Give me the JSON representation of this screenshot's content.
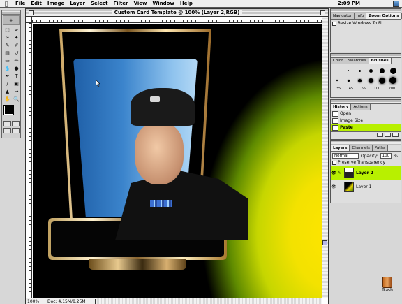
{
  "menubar": {
    "apple": "",
    "items": [
      "File",
      "Edit",
      "Image",
      "Layer",
      "Select",
      "Filter",
      "View",
      "Window",
      "Help"
    ],
    "clock": "2:09 PM"
  },
  "document": {
    "title": "Custom Card Template @ 100% (Layer 2,RGB)",
    "zoom": "100%",
    "doc_info": "Doc: 4.15M/8.25M"
  },
  "navigator": {
    "tabs": [
      "Navigator",
      "Info",
      "Zoom Options"
    ],
    "active_tab": "Zoom Options",
    "option_label": "Resize Windows To Fit"
  },
  "brushes": {
    "tabs": [
      "Color",
      "Swatches",
      "Brushes"
    ],
    "active_tab": "Brushes",
    "size_labels": [
      "35",
      "45",
      "65",
      "100",
      "200"
    ]
  },
  "history": {
    "tabs": [
      "History",
      "Actions"
    ],
    "active_tab": "History",
    "items": [
      {
        "label": "Open",
        "selected": false
      },
      {
        "label": "Image Size",
        "selected": false
      },
      {
        "label": "Paste",
        "selected": true
      }
    ]
  },
  "layers": {
    "tabs": [
      "Layers",
      "Channels",
      "Paths"
    ],
    "active_tab": "Layers",
    "blend_mode": "Normal",
    "opacity_label": "Opacity:",
    "opacity_value": "100",
    "opacity_unit": "%",
    "preserve_label": "Preserve Transparency",
    "items": [
      {
        "label": "Layer 2",
        "selected": true
      },
      {
        "label": "Layer 1",
        "selected": false
      }
    ]
  },
  "desktop": {
    "trash_label": "Trash"
  },
  "colors": {
    "selection_green": "#b8f000",
    "screen_blue": "#3b84cc",
    "bg_yellow": "#ffe500"
  }
}
